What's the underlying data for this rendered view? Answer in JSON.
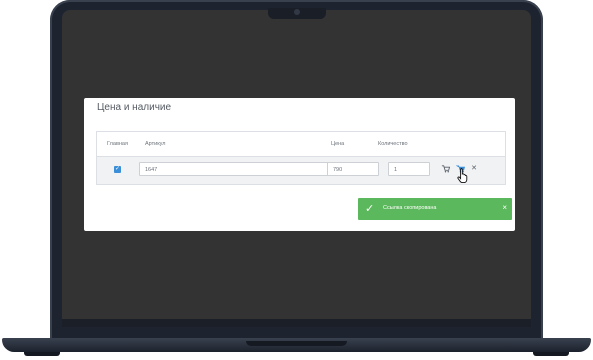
{
  "card": {
    "title": "Цена и наличие",
    "columns": [
      "Главная",
      "Артикул",
      "Цена",
      "Количество"
    ],
    "row": {
      "is_main": true,
      "article": "1647",
      "price": "790",
      "quantity": "1"
    }
  },
  "toast": {
    "message": "Ссылка скопирована",
    "close": "×"
  },
  "icons": {
    "row_actions": [
      "copy-link-icon",
      "cart-icon",
      "delete-icon"
    ],
    "checkmark": "✓"
  },
  "colors": {
    "toast_bg": "#5cb85c",
    "checkbox": "#3b8fd9",
    "screen_bg": "#333333",
    "laptop_frame": "#1d2430"
  }
}
